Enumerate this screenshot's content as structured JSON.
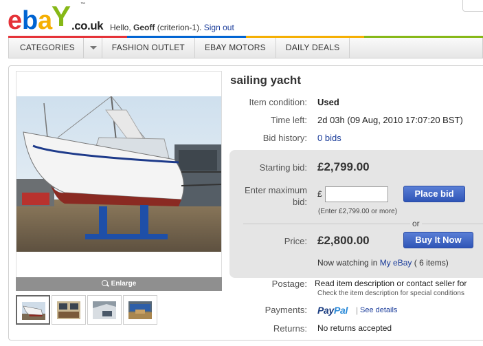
{
  "header": {
    "logo_letters": [
      "e",
      "b",
      "a",
      "Y"
    ],
    "logo_colors": [
      "#e53238",
      "#0064d2",
      "#f5af02",
      "#86b817"
    ],
    "logo_tm": "™",
    "logo_domain": ".co.uk",
    "greeting_prefix": "Hello,",
    "greeting_name": "Geoff",
    "greeting_id": "(criterion-1).",
    "sign_out": "Sign out"
  },
  "nav": {
    "categories": "CATEGORIES",
    "items": [
      "FASHION OUTLET",
      "EBAY MOTORS",
      "DAILY DEALS"
    ]
  },
  "listing": {
    "title": "sailing yacht",
    "condition_label": "Item condition:",
    "condition_value": "Used",
    "time_label": "Time left:",
    "time_value": "2d 03h (09 Aug, 2010  17:07:20 BST)",
    "history_label": "Bid history:",
    "history_value": "0 bids"
  },
  "bid": {
    "starting_label": "Starting bid:",
    "starting_value": "£2,799.00",
    "max_label_1": "Enter maximum",
    "max_label_2": "bid:",
    "currency": "£",
    "input_value": "",
    "place_bid": "Place bid",
    "hint": "(Enter £2,799.00 or more)",
    "or": "or",
    "price_label": "Price:",
    "price_value": "£2,800.00",
    "buy_now": "Buy It Now",
    "watching_prefix": "Now watching in",
    "watching_link": "My eBay",
    "watching_suffix": "( 6 items)"
  },
  "shipping": {
    "postage_label": "Postage:",
    "postage_value": "Read item description or contact seller for",
    "postage_note": "Check the item description for special conditions",
    "payments_label": "Payments:",
    "paypal_1": "Pay",
    "paypal_2": "Pal",
    "see_details": "See details",
    "returns_label": "Returns:",
    "returns_value": "No returns accepted"
  },
  "gallery": {
    "enlarge": "Enlarge",
    "thumbnail_count": 4
  },
  "colors": {
    "link": "#1a3c9a",
    "button": "#3a60c4",
    "bidbox_bg": "#e5e5e5",
    "color_bar": [
      "#e53238",
      "#0064d2",
      "#f5af02",
      "#86b817"
    ]
  }
}
